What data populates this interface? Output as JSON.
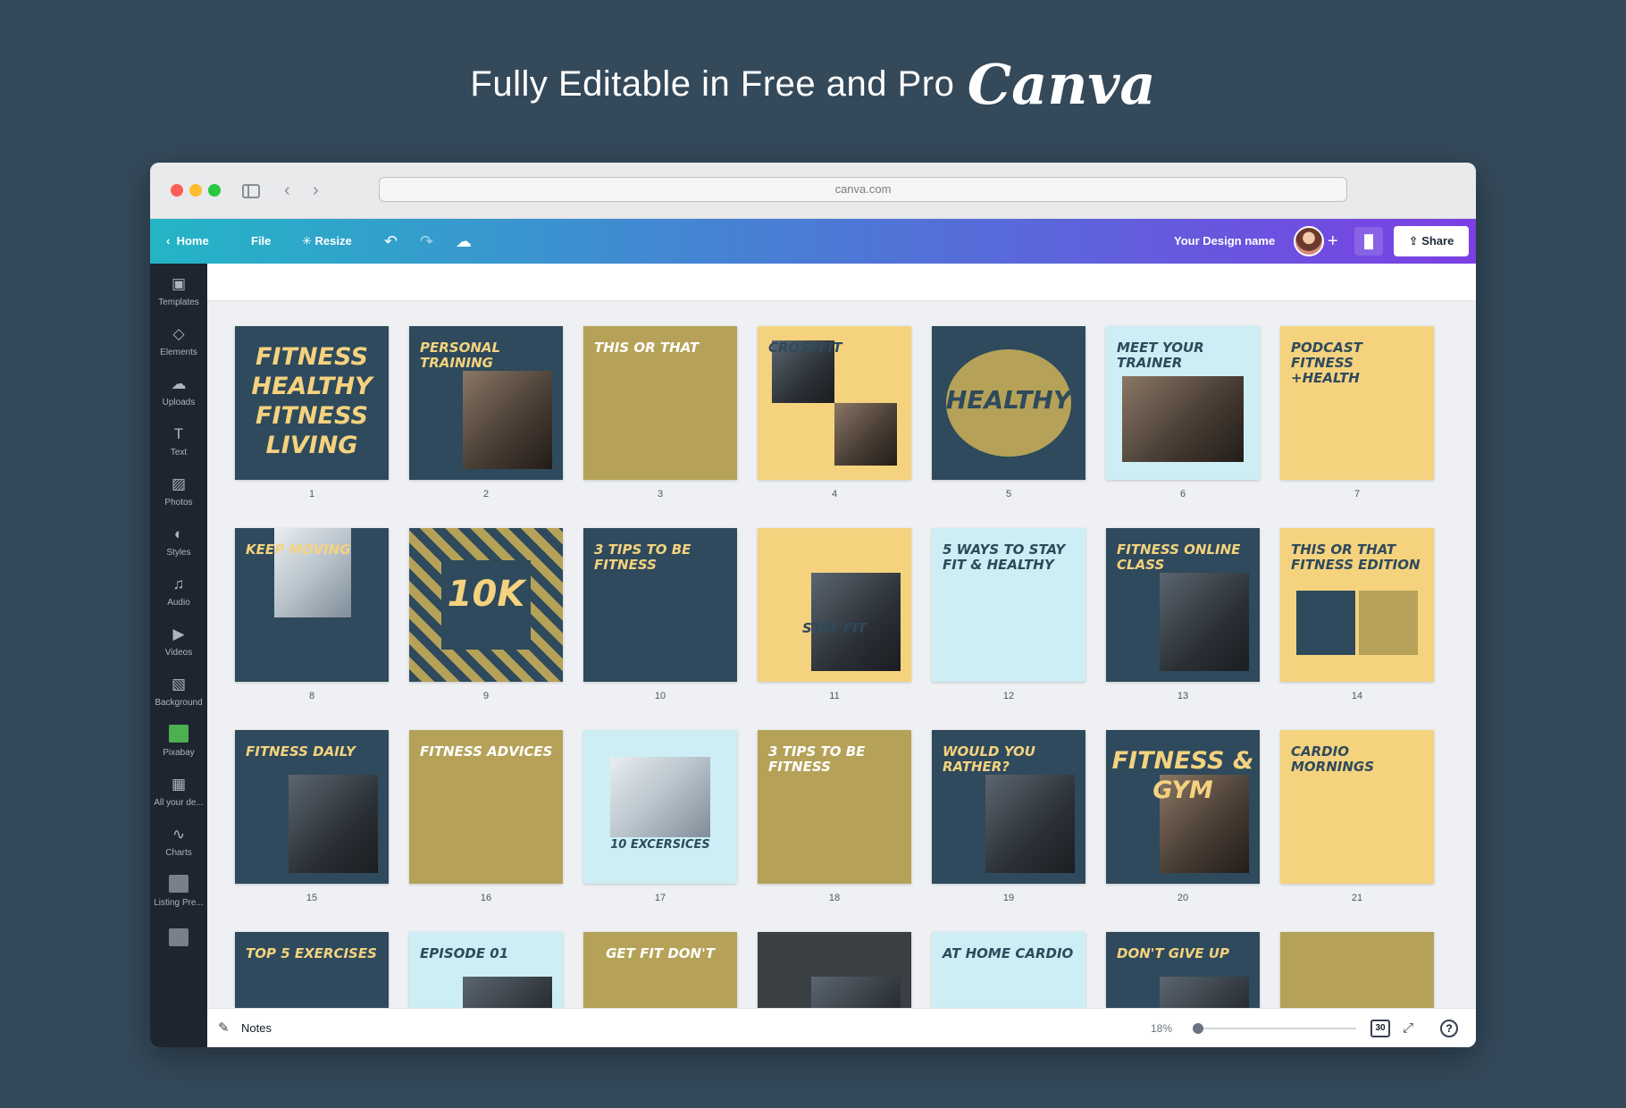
{
  "headline": {
    "lead": "Fully Editable in Free and Pro",
    "brand": "Canva"
  },
  "browser": {
    "url": "canva.com"
  },
  "toolbar": {
    "home": "Home",
    "file": "File",
    "resize": "Resize",
    "design_name": "Your Design name",
    "share": "Share"
  },
  "sidebar": {
    "items": [
      "Templates",
      "Elements",
      "Uploads",
      "Text",
      "Photos",
      "Styles",
      "Audio",
      "Videos",
      "Background",
      "Pixabay",
      "All your de...",
      "Charts",
      "Listing Pre..."
    ]
  },
  "tiles": [
    {
      "label": "1",
      "title": "FITNESS HEALTHY FITNESS LIVING"
    },
    {
      "label": "2",
      "title": "PERSONAL TRAINING"
    },
    {
      "label": "3",
      "title": "THIS OR THAT"
    },
    {
      "label": "4",
      "title": "CROSSFIT"
    },
    {
      "label": "5",
      "title": "HEALTHY"
    },
    {
      "label": "6",
      "title": "MEET YOUR TRAINER"
    },
    {
      "label": "7",
      "title": "PODCAST FITNESS +HEALTH"
    },
    {
      "label": "8",
      "title": "KEEP MOVING"
    },
    {
      "label": "9",
      "title": "10K"
    },
    {
      "label": "10",
      "title": "3 TIPS TO BE FITNESS"
    },
    {
      "label": "11",
      "title": "STAY FIT"
    },
    {
      "label": "12",
      "title": "5 WAYS TO STAY FIT & HEALTHY"
    },
    {
      "label": "13",
      "title": "FITNESS ONLINE CLASS"
    },
    {
      "label": "14",
      "title": "THIS OR THAT FITNESS EDITION"
    },
    {
      "label": "15",
      "title": "FITNESS DAILY"
    },
    {
      "label": "16",
      "title": "FITNESS ADVICES"
    },
    {
      "label": "17",
      "title": "10 EXCERSICES"
    },
    {
      "label": "18",
      "title": "3 TIPS TO BE FITNESS"
    },
    {
      "label": "19",
      "title": "WOULD YOU RATHER?"
    },
    {
      "label": "20",
      "title": "FITNESS & GYM"
    },
    {
      "label": "21",
      "title": "CARDIO MORNINGS"
    },
    {
      "label": "",
      "title": "TOP 5 EXERCISES"
    },
    {
      "label": "",
      "title": "EPISODE 01"
    },
    {
      "label": "",
      "title": "GET FIT DON'T"
    },
    {
      "label": "",
      "title": ""
    },
    {
      "label": "",
      "title": "AT HOME CARDIO"
    },
    {
      "label": "",
      "title": "DON'T GIVE UP"
    },
    {
      "label": "",
      "title": ""
    }
  ],
  "tile_styles": [
    "navy",
    "navy",
    "olive",
    "sand",
    "navy",
    "light",
    "sand",
    "navy",
    "olive",
    "navy",
    "sand",
    "light",
    "navy",
    "sand",
    "navy",
    "olive",
    "light",
    "olive",
    "navy",
    "navy",
    "sand",
    "navy",
    "light",
    "olive",
    "dark",
    "light",
    "navy",
    "olive"
  ],
  "bottom": {
    "notes": "Notes",
    "zoom": "18%",
    "pages": "30"
  },
  "icons": {
    "home": "chevron-left-icon",
    "resize": "sparkle-icon",
    "undo": "undo-icon",
    "redo": "redo-icon",
    "sync": "cloud-sync-icon",
    "insights": "bar-chart-icon",
    "share": "upload-icon",
    "notes": "notes-icon",
    "fullscreen": "expand-icon",
    "help": "question-icon"
  },
  "colors": {
    "navy": "#2e4a5c",
    "olive": "#b5a258",
    "sand": "#f5d27e",
    "light": "#cdeef4",
    "page_bg": "#34495a"
  }
}
